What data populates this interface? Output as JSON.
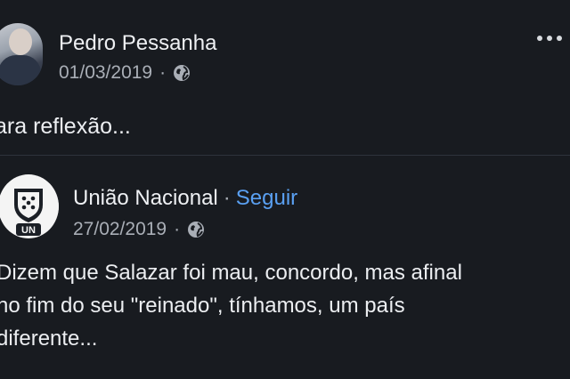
{
  "post": {
    "author": "Pedro Pessanha",
    "date": "01/03/2019",
    "separator": "·",
    "privacy_icon": "globe-icon",
    "more_icon": "more-options-icon",
    "text": "ara reflexão..."
  },
  "shared_post": {
    "author": "União Nacional",
    "separator": "·",
    "follow_label": "Seguir",
    "date": "27/02/2019",
    "privacy_icon": "globe-icon",
    "logo_text": "UN",
    "body_lines": [
      "Dizem que Salazar foi mau, concordo, mas afinal",
      "no fim do seu \"reinado\", tínhamos, um país",
      "diferente..."
    ]
  },
  "colors": {
    "background": "#181b20",
    "text_primary": "#eef0f3",
    "text_secondary": "#a9aeb6",
    "link": "#5aa0f2"
  }
}
